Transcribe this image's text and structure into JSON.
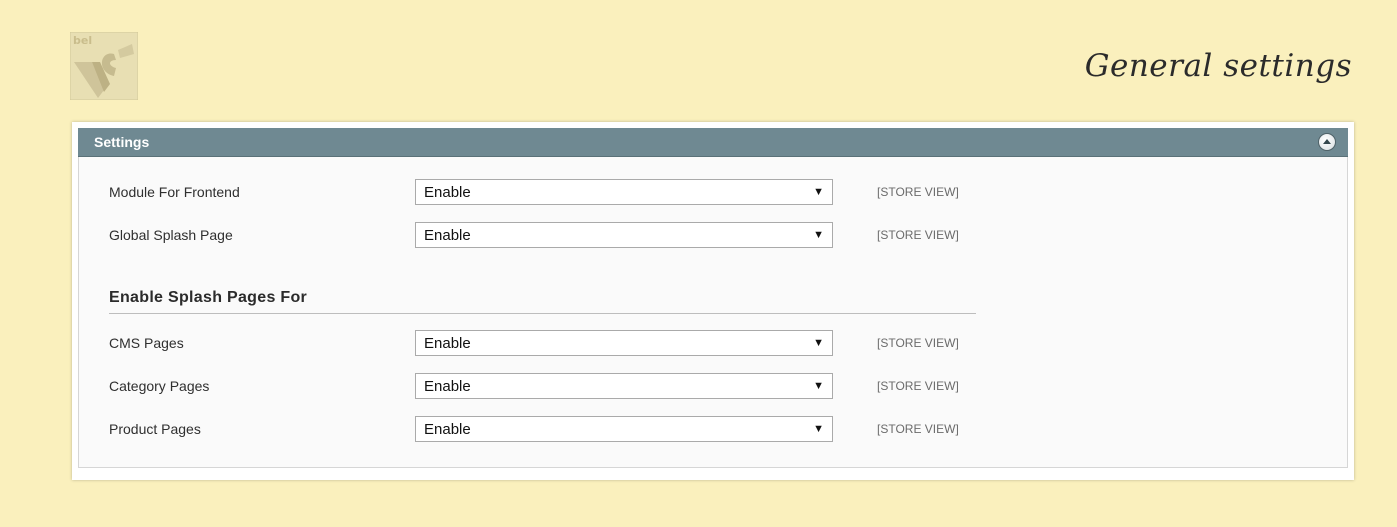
{
  "page": {
    "title": "General settings"
  },
  "panel": {
    "title": "Settings",
    "section_heading": "Enable Splash Pages For",
    "rows": [
      {
        "label": "Module For Frontend",
        "value": "Enable",
        "scope": "[STORE VIEW]"
      },
      {
        "label": "Global Splash Page",
        "value": "Enable",
        "scope": "[STORE VIEW]"
      },
      {
        "label": "CMS Pages",
        "value": "Enable",
        "scope": "[STORE VIEW]"
      },
      {
        "label": "Category Pages",
        "value": "Enable",
        "scope": "[STORE VIEW]"
      },
      {
        "label": "Product Pages",
        "value": "Enable",
        "scope": "[STORE VIEW]"
      }
    ]
  },
  "icons": {
    "logo": "brand-logo",
    "collapse": "collapse-up-icon",
    "dropdown": "dropdown-arrow-icon"
  },
  "colors": {
    "background": "#faf0bd",
    "header": "#6f8992",
    "panel": "#fafafa"
  }
}
